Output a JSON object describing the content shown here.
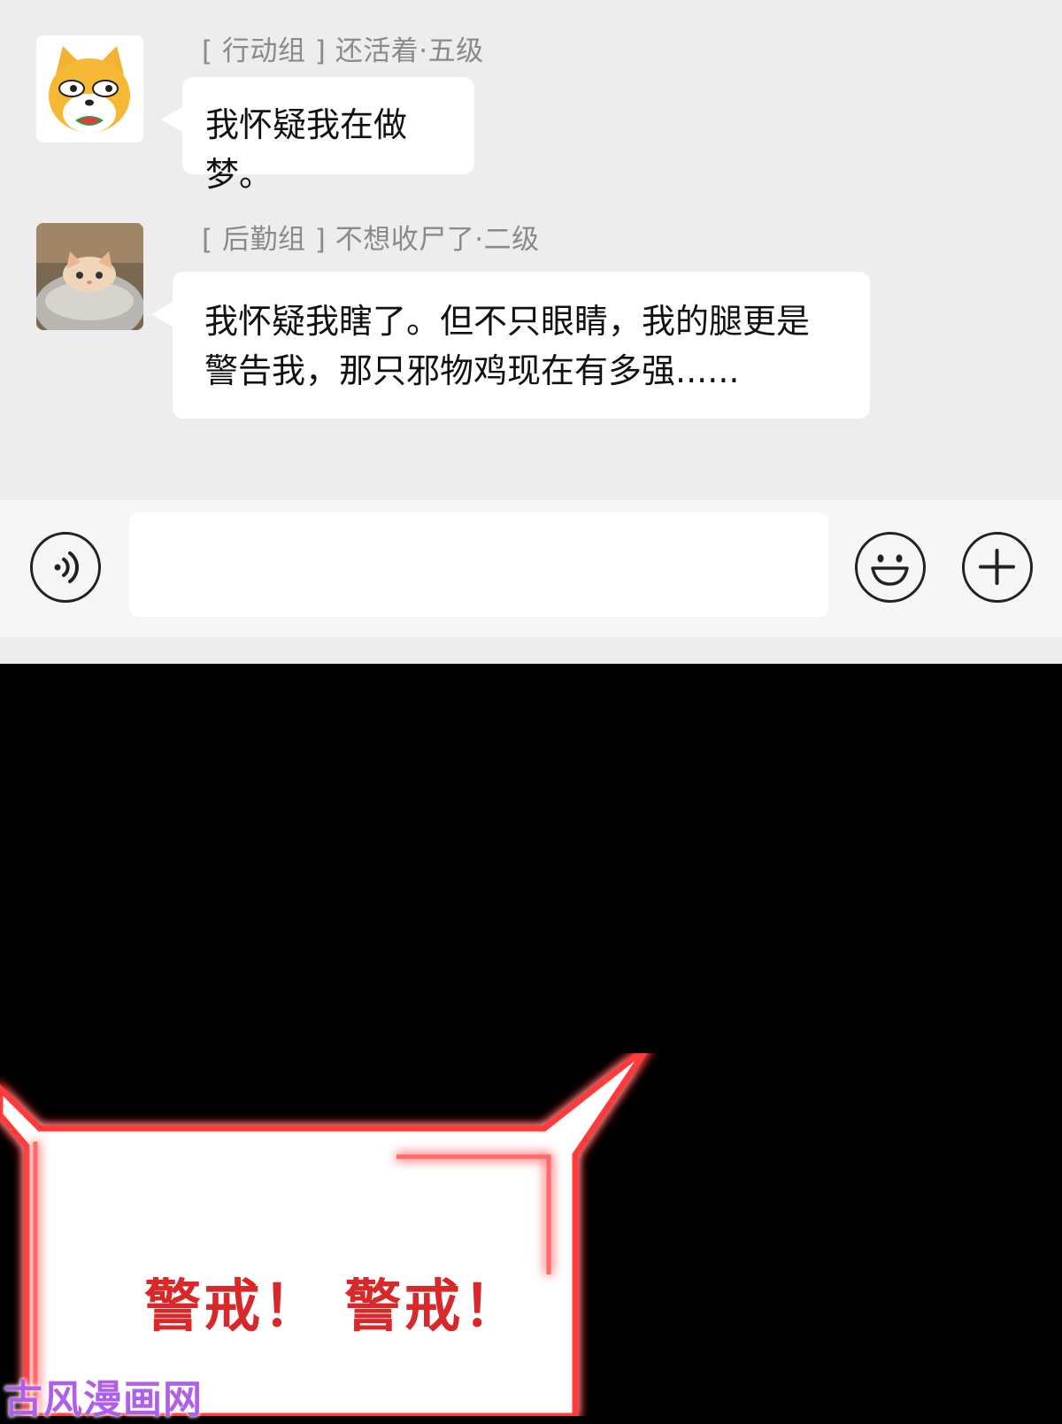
{
  "messages": [
    {
      "sender": "[ 行动组 ] 还活着·五级",
      "text": "我怀疑我在做梦。",
      "avatar_icon": "shiba-dog-avatar"
    },
    {
      "sender": "[ 后勤组 ] 不想收尸了·二级",
      "text_line1": "我怀疑我瞎了。但不只眼睛，我的腿更是",
      "text_line2": "警告我，那只邪物鸡现在有多强......",
      "avatar_icon": "cat-in-pot-avatar"
    }
  ],
  "input_bar": {
    "voice_icon": "voice-icon",
    "emoji_icon": "emoji-icon",
    "plus_icon": "plus-icon"
  },
  "comic_panel": {
    "alert_text": "警戒！ 警戒！",
    "alert_color": "#d8282a"
  },
  "watermark": "古风漫画网"
}
